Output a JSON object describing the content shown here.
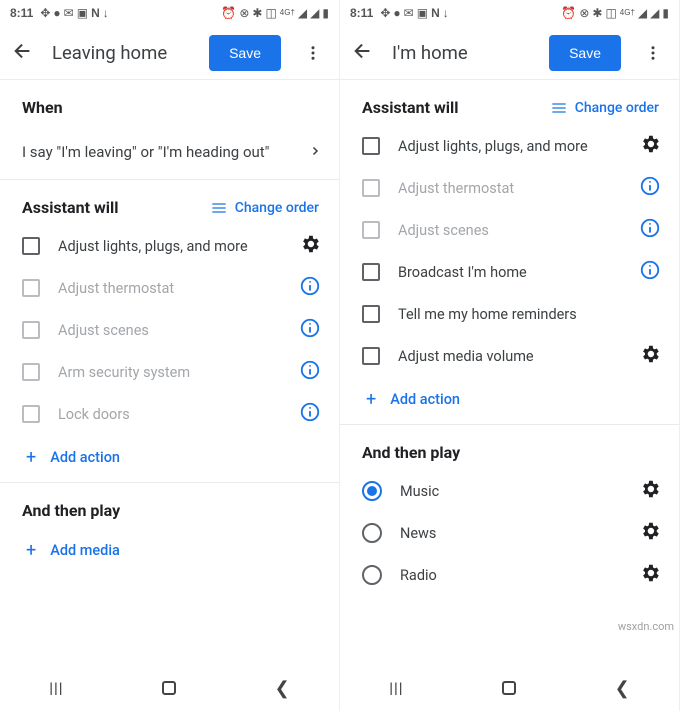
{
  "status": {
    "time": "8:11",
    "left_icons": [
      "✥",
      "●",
      "✉",
      "▣",
      "N",
      "↓"
    ],
    "right_icons": [
      "⏰",
      "⊗",
      "✱",
      "◼",
      "ᴴᴳᵗ",
      "▮◢",
      "◢",
      "▮"
    ]
  },
  "watermark": "wsxdn.com",
  "left": {
    "title": "Leaving home",
    "save": "Save",
    "when_header": "When",
    "trigger_text": "I say \"I'm leaving\" or \"I'm heading out\"",
    "assistant_header": "Assistant will",
    "change_order": "Change order",
    "items": [
      {
        "label": "Adjust lights, plugs, and more",
        "enabled": true,
        "trailing": "gear"
      },
      {
        "label": "Adjust thermostat",
        "enabled": false,
        "trailing": "info"
      },
      {
        "label": "Adjust scenes",
        "enabled": false,
        "trailing": "info"
      },
      {
        "label": "Arm security system",
        "enabled": false,
        "trailing": "info"
      },
      {
        "label": "Lock doors",
        "enabled": false,
        "trailing": "info"
      }
    ],
    "add_action": "Add action",
    "play_header": "And then play",
    "add_media": "Add media"
  },
  "right": {
    "title": "I'm home",
    "save": "Save",
    "assistant_header": "Assistant will",
    "change_order": "Change order",
    "items": [
      {
        "label": "Adjust lights, plugs, and more",
        "enabled": true,
        "trailing": "gear"
      },
      {
        "label": "Adjust thermostat",
        "enabled": false,
        "trailing": "info"
      },
      {
        "label": "Adjust scenes",
        "enabled": false,
        "trailing": "info"
      },
      {
        "label": "Broadcast I'm home",
        "enabled": true,
        "trailing": "info"
      },
      {
        "label": "Tell me my home reminders",
        "enabled": true,
        "trailing": "none"
      },
      {
        "label": "Adjust media volume",
        "enabled": true,
        "trailing": "gear"
      }
    ],
    "add_action": "Add action",
    "play_header": "And then play",
    "play_items": [
      {
        "label": "Music",
        "selected": true,
        "trailing": "gear"
      },
      {
        "label": "News",
        "selected": false,
        "trailing": "gear"
      },
      {
        "label": "Radio",
        "selected": false,
        "trailing": "gear"
      }
    ]
  }
}
